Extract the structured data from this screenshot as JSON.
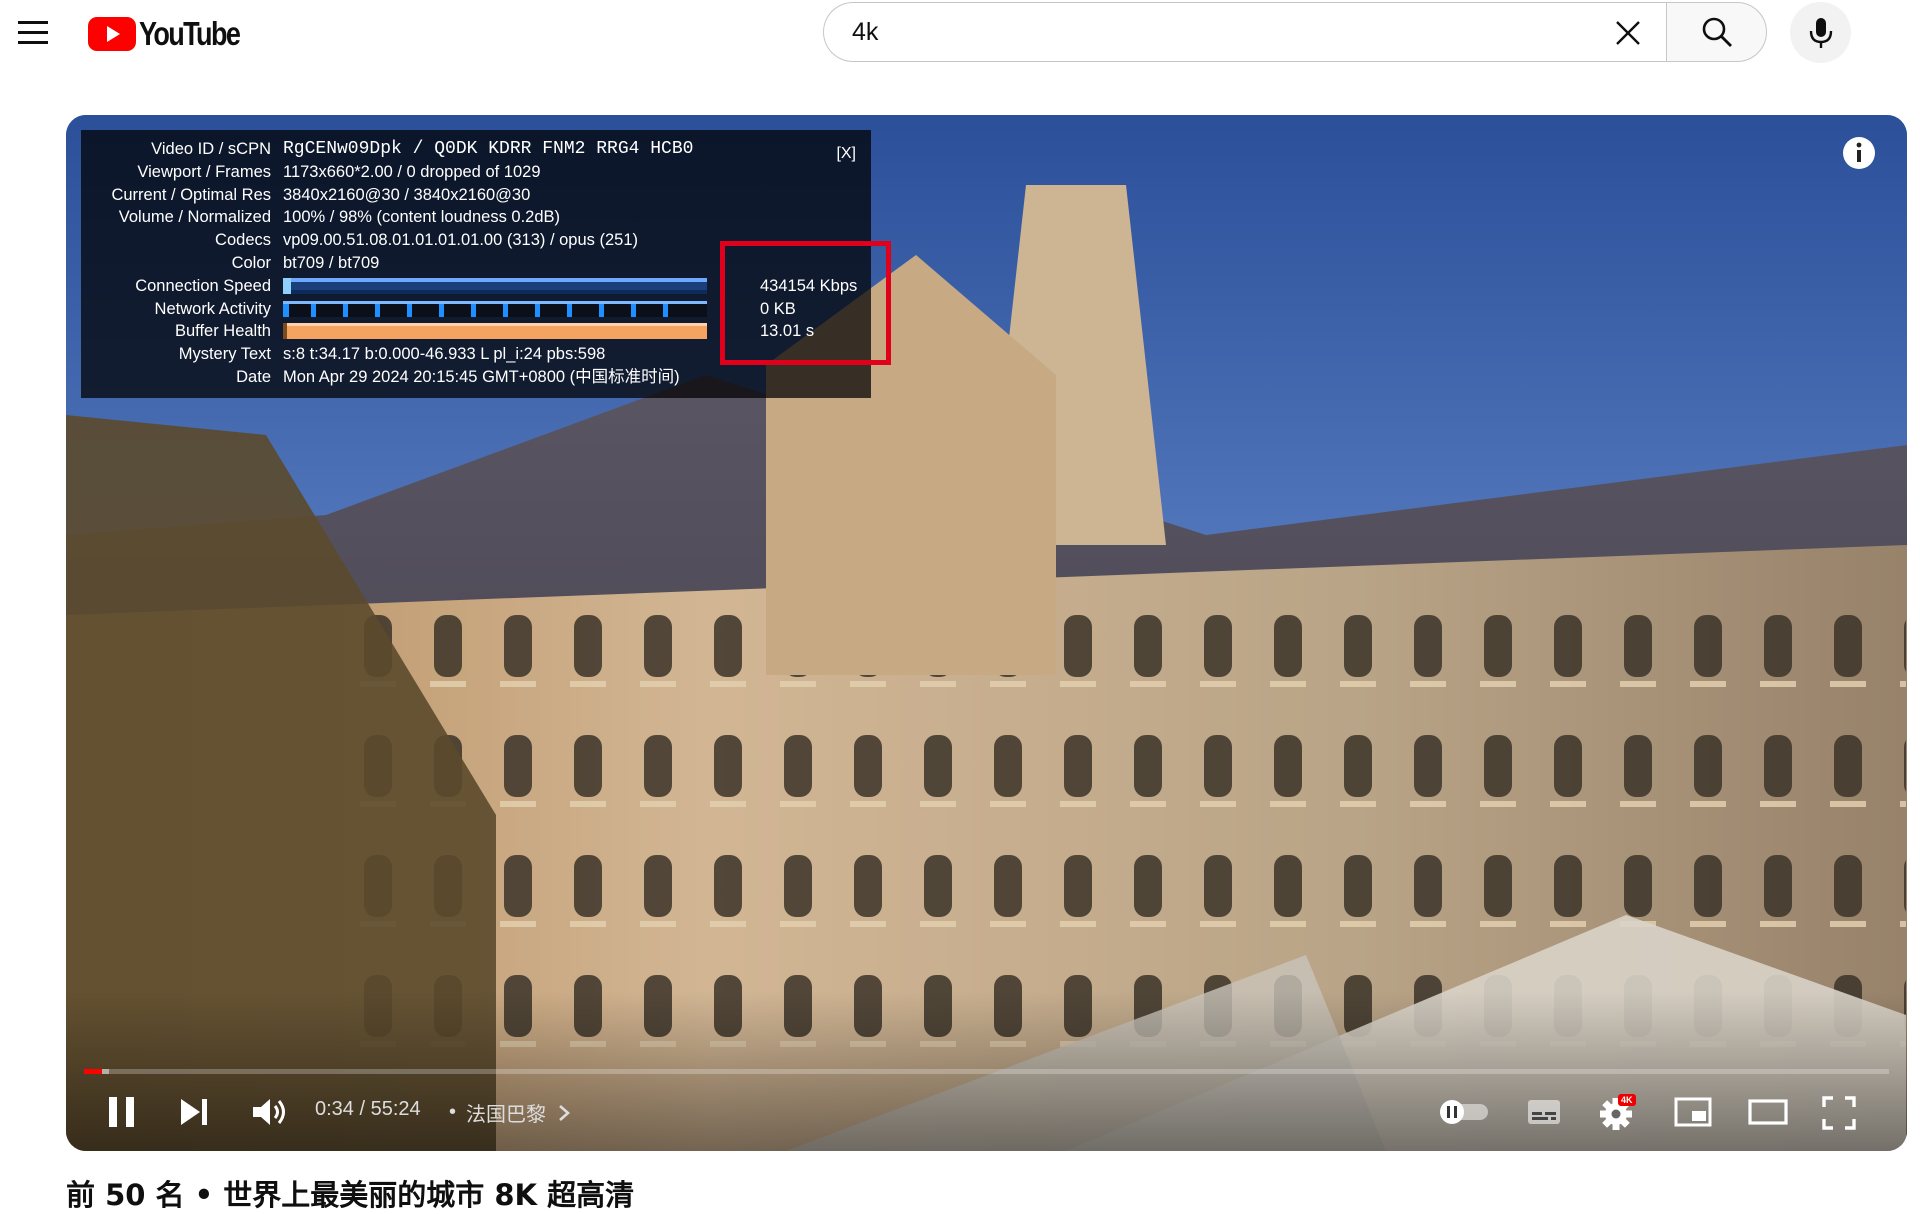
{
  "masthead": {
    "logo_text": "YouTube",
    "search_value": "4k",
    "colors": {
      "logo_red": "#ff0000",
      "search_border": "#c6c6c6"
    },
    "icons": [
      "menu-icon",
      "clear-icon",
      "search-icon",
      "mic-icon"
    ]
  },
  "stats": {
    "close_label": "[X]",
    "rows": [
      {
        "label": "Video ID / sCPN",
        "value": "RgCENw09Dpk / Q0DK KDRR FNM2 RRG4 HCB0"
      },
      {
        "label": "Viewport / Frames",
        "value": "1173x660*2.00 / 0 dropped of 1029"
      },
      {
        "label": "Current / Optimal Res",
        "value": "3840x2160@30 / 3840x2160@30"
      },
      {
        "label": "Volume / Normalized",
        "value": "100% / 98% (content loudness 0.2dB)"
      },
      {
        "label": "Codecs",
        "value": "vp09.00.51.08.01.01.01.01.00 (313) / opus (251)"
      },
      {
        "label": "Color",
        "value": "bt709 / bt709"
      },
      {
        "label": "Connection Speed",
        "value": "434154 Kbps"
      },
      {
        "label": "Network Activity",
        "value": "0 KB"
      },
      {
        "label": "Buffer Health",
        "value": "13.01 s"
      },
      {
        "label": "Mystery Text",
        "value": "s:8 t:34.17 b:0.000-46.933 L pl_i:24 pbs:598"
      },
      {
        "label": "Date",
        "value": "Mon Apr 29 2024 20:15:45 GMT+0800 (中国标准时间)"
      }
    ],
    "colors": {
      "connection": "#2f6fd6",
      "network": "#1e90ff",
      "buffer": "#f4a460",
      "highlight": "#e0001b"
    }
  },
  "player": {
    "time_current": "0:34",
    "time_sep": " / ",
    "time_total": "55:24",
    "chapter_sep": "•",
    "chapter": "法国巴黎",
    "progress_played": 0.0102,
    "progress_buffered": 0.0141,
    "quality_badge": "4K",
    "icons": [
      "pause-icon",
      "next-icon",
      "volume-icon",
      "autoplay-toggle-icon",
      "subtitles-icon",
      "settings-icon",
      "miniplayer-icon",
      "theater-icon",
      "fullscreen-icon",
      "info-icon"
    ]
  },
  "video": {
    "title": "前 50 名 • 世界上最美丽的城市 8K 超高清"
  }
}
